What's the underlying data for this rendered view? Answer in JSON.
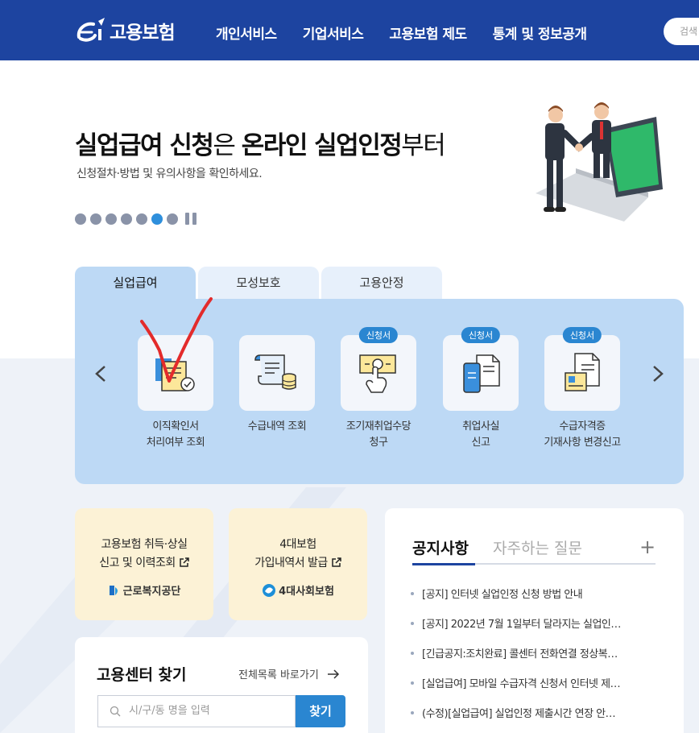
{
  "header": {
    "logo_text": "고용보험",
    "nav": [
      "개인서비스",
      "기업서비스",
      "고용보험 제도",
      "통계 및 정보공개"
    ],
    "search_placeholder": "검색"
  },
  "hero": {
    "title_part1": "실업급여 신청",
    "title_part2": "은 ",
    "title_part3": "온라인 실업인정",
    "title_part4": "부터",
    "subtitle": "신청절차·방법 및 유의사항을 확인하세요."
  },
  "tabs": [
    "실업급여",
    "모성보호",
    "고용안정"
  ],
  "services": [
    {
      "label_line1": "이직확인서",
      "label_line2": "처리여부 조회",
      "badge": ""
    },
    {
      "label_line1": "수급내역 조회",
      "label_line2": "",
      "badge": ""
    },
    {
      "label_line1": "조기재취업수당",
      "label_line2": "청구",
      "badge": "신청서"
    },
    {
      "label_line1": "취업사실",
      "label_line2": "신고",
      "badge": "신청서"
    },
    {
      "label_line1": "수급자격증",
      "label_line2": "기재사항 변경신고",
      "badge": "신청서"
    }
  ],
  "cards": [
    {
      "line1": "고용보험 취득·상실",
      "line2": "신고 및 이력조회",
      "org": "근로복지공단"
    },
    {
      "line1": "4대보험",
      "line2": "가입내역서 발급",
      "org": "4대사회보험"
    }
  ],
  "finder": {
    "title": "고용센터 찾기",
    "link": "전체목록 바로가기",
    "placeholder": "시/구/동 명을 입력",
    "button": "찾기"
  },
  "notice": {
    "tab_active": "공지사항",
    "tab_inactive": "자주하는 질문",
    "plus": "+",
    "items": [
      "[공지] 인터넷 실업인정 신청 방법 안내",
      "[공지] 2022년 7월 1일부터 달라지는 실업인…",
      "[긴급공지:조치완료] 콜센터 전화연결 정상복…",
      "[실업급여] 모바일 수급자격 신청서 인터넷 제…",
      "(수정)[실업급여] 실업인정 제출시간 연장 안…"
    ]
  },
  "colors": {
    "brand": "#1d44a0",
    "accent": "#2a86d1",
    "panel": "#bdd9f5",
    "card": "#fcf2d6",
    "annotation": "#e32b2b"
  }
}
